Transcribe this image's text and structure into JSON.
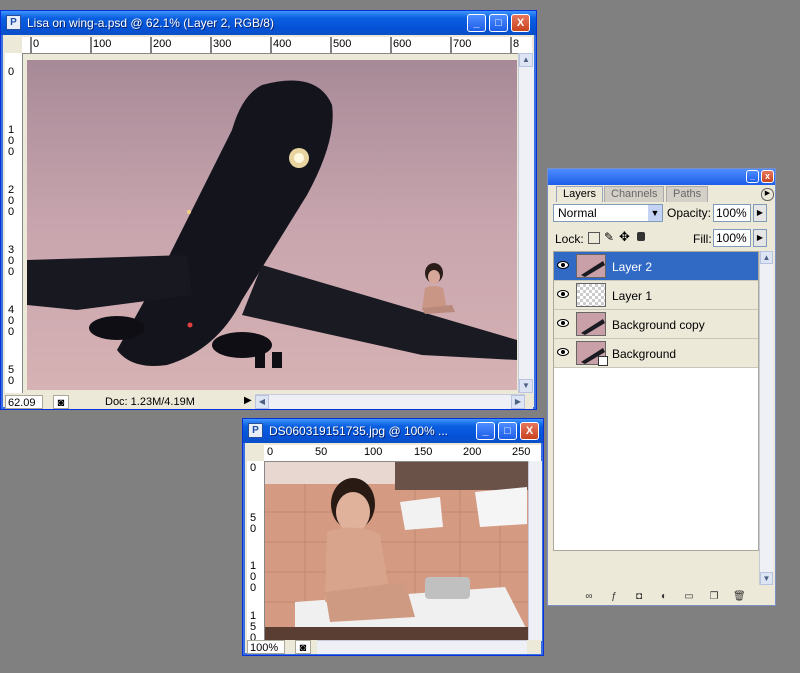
{
  "main_window": {
    "title": "Lisa on wing-a.psd @ 62.1% (Layer 2, RGB/8)",
    "minimize": "_",
    "maximize": "□",
    "close": "X",
    "ruler_h": [
      "0",
      "100",
      "200",
      "300",
      "400",
      "500",
      "600",
      "700",
      "8"
    ],
    "ruler_v": [
      "0",
      "1\n0\n0",
      "2\n0\n0",
      "3\n0\n0",
      "4\n0\n0",
      "5\n0"
    ],
    "zoom": "62.09",
    "doc_info": "Doc: 1.23M/4.19M"
  },
  "second_window": {
    "title": "DS060319151735.jpg @ 100% ...",
    "minimize": "_",
    "maximize": "□",
    "close": "X",
    "ruler_h": [
      "0",
      "50",
      "100",
      "150",
      "200",
      "250"
    ],
    "ruler_v": [
      "0",
      "5\n0",
      "1\n0\n0",
      "1\n5\n0"
    ],
    "zoom": "100%"
  },
  "layers_panel": {
    "tabs": [
      "Layers",
      "Channels",
      "Paths"
    ],
    "blend_mode": "Normal",
    "opacity_label": "Opacity:",
    "opacity_value": "100%",
    "lock_label": "Lock:",
    "fill_label": "Fill:",
    "fill_value": "100%",
    "layers": [
      {
        "name": "Layer 2",
        "selected": true
      },
      {
        "name": "Layer 1",
        "selected": false
      },
      {
        "name": "Background copy",
        "selected": false
      },
      {
        "name": "Background",
        "selected": false
      }
    ]
  },
  "colors": {
    "titlebar_blue": "#0553d8",
    "selection": "#316ac5",
    "sky": "#c9a0a8",
    "workspace": "#808080"
  }
}
